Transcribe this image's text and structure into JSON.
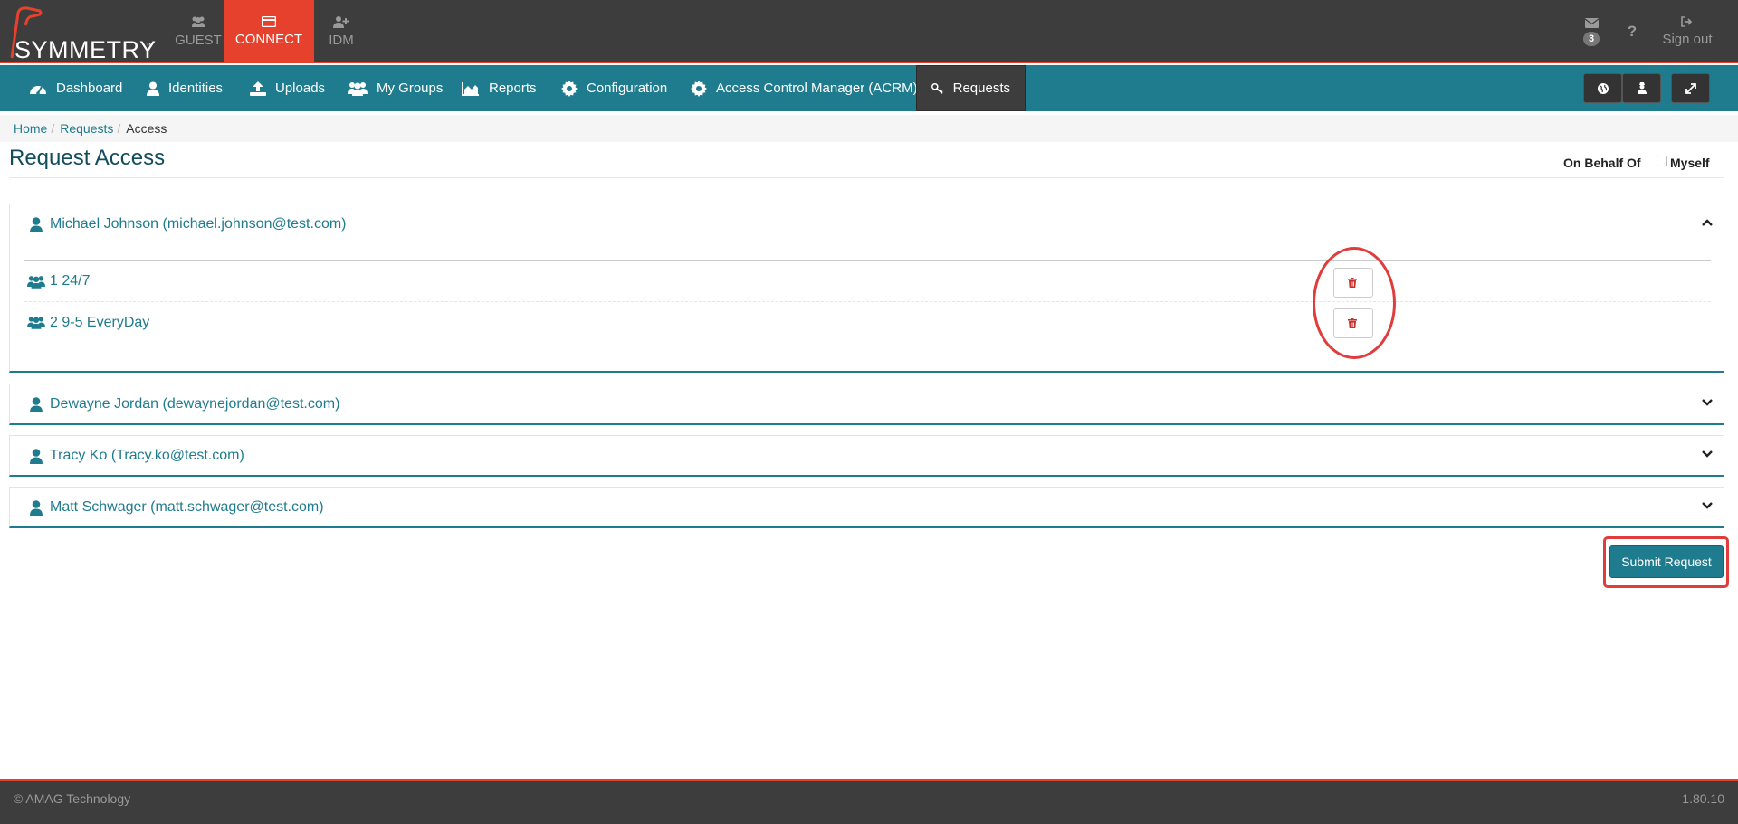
{
  "brand": {
    "name": "SYMMETRY",
    "tm": "™"
  },
  "app_tabs": {
    "guest": "GUEST",
    "connect": "CONNECT",
    "idm": "IDM"
  },
  "top_right": {
    "mail_count": "3",
    "help": "?",
    "signout": "Sign out"
  },
  "nav": {
    "dashboard": "Dashboard",
    "identities": "Identities",
    "uploads": "Uploads",
    "my_groups": "My Groups",
    "reports": "Reports",
    "configuration": "Configuration",
    "acrm": "Access Control Manager (ACRM)",
    "requests": "Requests"
  },
  "breadcrumb": {
    "home": "Home",
    "requests": "Requests",
    "current": "Access",
    "sep": "/"
  },
  "page": {
    "title": "Request Access",
    "on_behalf_of": "On Behalf Of",
    "myself": "Myself"
  },
  "requests": [
    {
      "name": "Michael Johnson (michael.johnson@test.com)",
      "expanded": true,
      "groups": [
        "1 24/7",
        "2 9-5 EveryDay"
      ]
    },
    {
      "name": "Dewayne Jordan (dewaynejordan@test.com)",
      "expanded": false
    },
    {
      "name": "Tracy Ko (Tracy.ko@test.com)",
      "expanded": false
    },
    {
      "name": "Matt Schwager (matt.schwager@test.com)",
      "expanded": false
    }
  ],
  "submit_label": "Submit Request",
  "footer": {
    "copyright": "© AMAG Technology",
    "version": "1.80.10"
  },
  "colors": {
    "accent": "#1f7c8e",
    "brand_red": "#e5412d",
    "dark_bar": "#3d3d3d",
    "highlight": "#e03c3c"
  }
}
